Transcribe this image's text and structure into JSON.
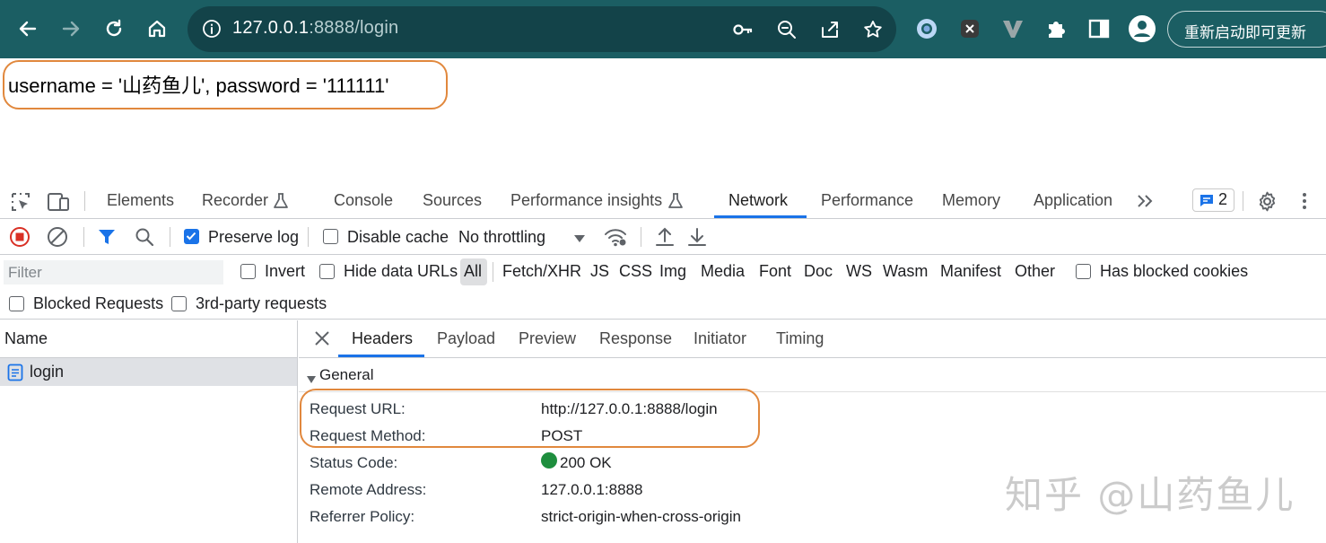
{
  "browser": {
    "url_host": "127.0.0.1",
    "url_path": ":8888/login",
    "update_button": "重新启动即可更新"
  },
  "page": {
    "content": "username = '山药鱼儿', password = '111111'"
  },
  "devtools": {
    "tabs": [
      "Elements",
      "Recorder",
      "Console",
      "Sources",
      "Performance insights",
      "Network",
      "Performance",
      "Memory",
      "Application"
    ],
    "active_tab": "Network",
    "issues_count": "2",
    "toolbar": {
      "preserve_log": "Preserve log",
      "preserve_log_checked": true,
      "disable_cache": "Disable cache",
      "throttling": "No throttling"
    },
    "filter": {
      "placeholder": "Filter",
      "invert": "Invert",
      "hide_data_urls": "Hide data URLs",
      "types": [
        "All",
        "Fetch/XHR",
        "JS",
        "CSS",
        "Img",
        "Media",
        "Font",
        "Doc",
        "WS",
        "Wasm",
        "Manifest",
        "Other"
      ],
      "has_blocked_cookies": "Has blocked cookies",
      "blocked_requests": "Blocked Requests",
      "third_party": "3rd-party requests"
    },
    "requests": {
      "column_header": "Name",
      "items": [
        "login"
      ]
    },
    "detail": {
      "tabs": [
        "Headers",
        "Payload",
        "Preview",
        "Response",
        "Initiator",
        "Timing"
      ],
      "active_tab": "Headers",
      "section": "General",
      "rows": [
        {
          "key": "Request URL:",
          "value": "http://127.0.0.1:8888/login"
        },
        {
          "key": "Request Method:",
          "value": "POST"
        },
        {
          "key": "Status Code:",
          "value": "200 OK"
        },
        {
          "key": "Remote Address:",
          "value": "127.0.0.1:8888"
        },
        {
          "key": "Referrer Policy:",
          "value": "strict-origin-when-cross-origin"
        }
      ]
    }
  },
  "watermark": "知乎 @山药鱼儿",
  "colors": {
    "toolbar_bg": "#1b5e63",
    "highlight": "#e1883d",
    "accent": "#1a73e8",
    "status_ok": "#1e8e3e"
  }
}
